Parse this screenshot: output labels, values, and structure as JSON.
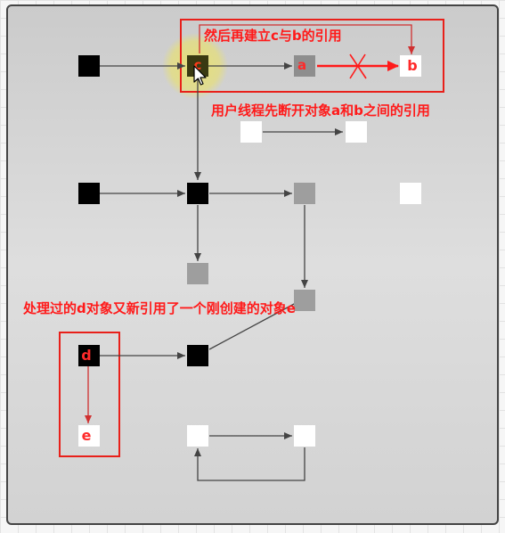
{
  "annotations": {
    "top": "然后再建立c与b的引用",
    "middle": "用户线程先断开对象a和b之间的引用",
    "bottom": "处理过的d对象又新引用了一个刚创建的对象e"
  },
  "node_labels": {
    "a": "a",
    "b": "b",
    "c": "c",
    "d": "d",
    "e": "e"
  },
  "colors": {
    "black_node": "#000000",
    "gray_node": "#9e9e9e",
    "white_node": "#ffffff",
    "annotation_red": "#ff1a1a",
    "panel_bg": "#d9d9d9",
    "edge": "#444444",
    "highlight": "#e8e36a"
  },
  "icons": [
    "mouse-pointer-icon",
    "cross-out-icon"
  ]
}
